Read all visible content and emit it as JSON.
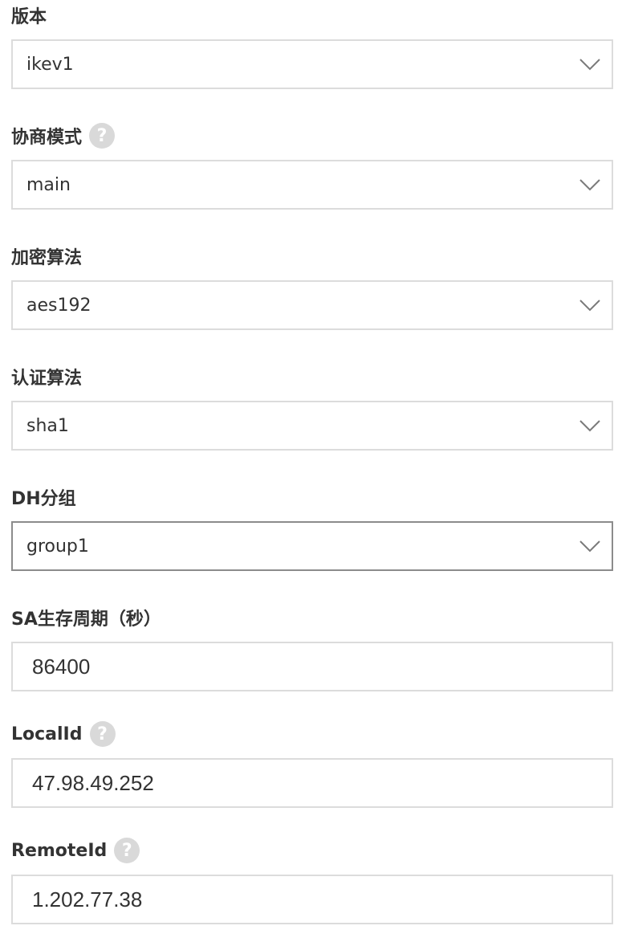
{
  "form": {
    "version": {
      "label": "版本",
      "value": "ikev1"
    },
    "negotiation_mode": {
      "label": "协商模式",
      "help_icon": "question-mark-icon",
      "help_glyph": "?",
      "value": "main"
    },
    "encryption_algorithm": {
      "label": "加密算法",
      "value": "aes192"
    },
    "auth_algorithm": {
      "label": "认证算法",
      "value": "sha1"
    },
    "dh_group": {
      "label": "DH分组",
      "value": "group1"
    },
    "sa_lifetime": {
      "label": "SA生存周期（秒）",
      "value": "86400"
    },
    "local_id": {
      "label": "LocalId",
      "help_icon": "question-mark-icon",
      "help_glyph": "?",
      "value": "47.98.49.252"
    },
    "remote_id": {
      "label": "RemoteId",
      "help_icon": "question-mark-icon",
      "help_glyph": "?",
      "value": "1.202.77.38"
    }
  },
  "colors": {
    "border": "#dcdcdc",
    "border_active": "#8c8c8c",
    "text": "#333333",
    "help_icon_bg": "#d9d9d9",
    "chevron": "#7a7a7a"
  }
}
